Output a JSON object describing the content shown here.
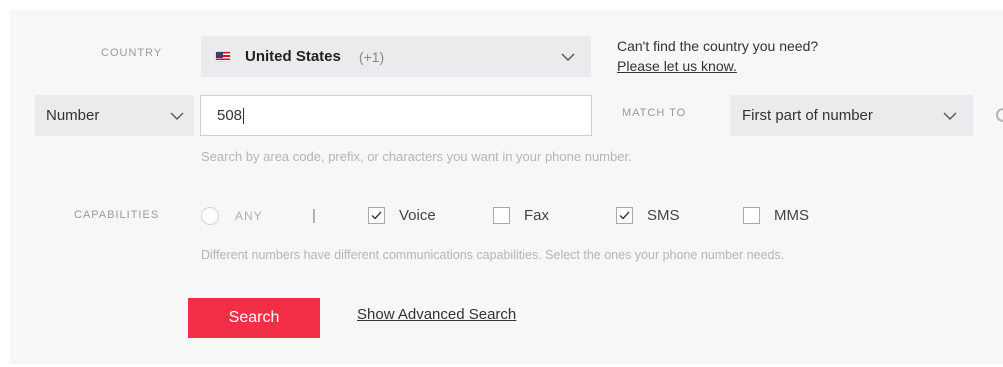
{
  "country": {
    "label": "COUNTRY",
    "selected": "United States",
    "dial_code": "(+1)",
    "flag_icon": "us-flag-icon",
    "help_text": "Can't find the country you need?",
    "help_link": "Please let us know."
  },
  "search_type": {
    "selected": "Number",
    "input_value": "508",
    "match_label": "MATCH TO",
    "match_selected": "First part of number",
    "hint": "Search by area code, prefix, or characters you want in your phone number."
  },
  "capabilities": {
    "label": "CAPABILITIES",
    "any_label": "ANY",
    "separator": "|",
    "options": [
      {
        "label": "Voice",
        "checked": true
      },
      {
        "label": "Fax",
        "checked": false
      },
      {
        "label": "SMS",
        "checked": true
      },
      {
        "label": "MMS",
        "checked": false
      }
    ],
    "hint": "Different numbers have different communications capabilities. Select the ones your phone number needs."
  },
  "actions": {
    "search_label": "Search",
    "advanced_label": "Show Advanced Search"
  },
  "colors": {
    "accent": "#f22f46",
    "panel_bg": "#f7f7f8",
    "select_bg": "#ebebed"
  }
}
